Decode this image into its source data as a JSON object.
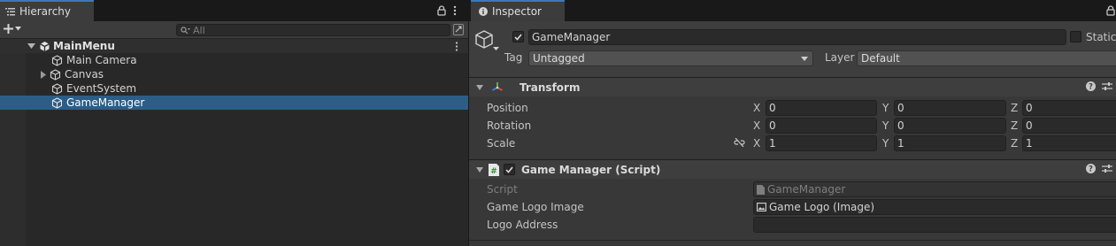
{
  "hierarchy": {
    "tab_label": "Hierarchy",
    "search_placeholder": "All",
    "scene_name": "MainMenu",
    "items": [
      {
        "label": "Main Camera"
      },
      {
        "label": "Canvas"
      },
      {
        "label": "EventSystem"
      },
      {
        "label": "GameManager"
      }
    ]
  },
  "inspector": {
    "tab_label": "Inspector",
    "object_name": "GameManager",
    "static_label": "Static",
    "tag_label": "Tag",
    "tag_value": "Untagged",
    "layer_label": "Layer",
    "layer_value": "Default",
    "transform": {
      "title": "Transform",
      "position": {
        "label": "Position",
        "x": "0",
        "y": "0",
        "z": "0"
      },
      "rotation": {
        "label": "Rotation",
        "x": "0",
        "y": "0",
        "z": "0"
      },
      "scale": {
        "label": "Scale",
        "x": "1",
        "y": "1",
        "z": "1"
      },
      "axis_x": "X",
      "axis_y": "Y",
      "axis_z": "Z"
    },
    "script_component": {
      "title": "Game Manager (Script)",
      "script_label": "Script",
      "script_value": "GameManager",
      "logo_image_label": "Game Logo Image",
      "logo_image_value": "Game Logo (Image)",
      "logo_address_label": "Logo Address",
      "logo_address_value": ""
    }
  },
  "colors": {
    "selection": "#2c5d87",
    "tab_accent": "#3a79bb",
    "panel_bg": "#383838"
  }
}
